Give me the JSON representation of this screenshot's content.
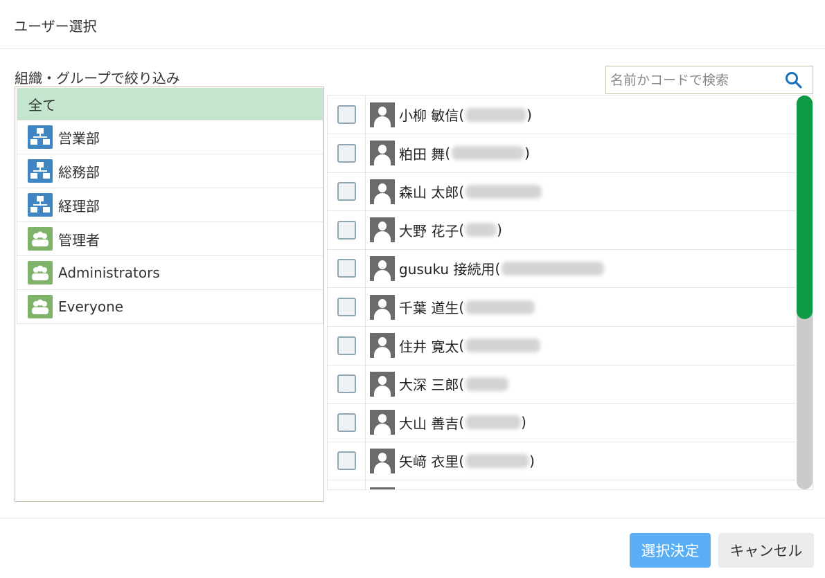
{
  "dialog": {
    "title": "ユーザー選択"
  },
  "filter": {
    "label": "組織・グループで絞り込み",
    "groups": [
      {
        "label": "全て",
        "type": "all",
        "selected": true
      },
      {
        "label": "営業部",
        "type": "organization-icon"
      },
      {
        "label": "総務部",
        "type": "organization-icon"
      },
      {
        "label": "経理部",
        "type": "organization-icon"
      },
      {
        "label": "管理者",
        "type": "group-icon"
      },
      {
        "label": "Administrators",
        "type": "group-icon"
      },
      {
        "label": "Everyone",
        "type": "group-icon"
      }
    ]
  },
  "search": {
    "placeholder": "名前かコードで検索",
    "icon": "search-icon"
  },
  "users": [
    {
      "name": "小柳 敏信",
      "open": "(",
      "close": ")"
    },
    {
      "name": "粕田 舞",
      "open": "(",
      "close": ")"
    },
    {
      "name": "森山 太郎",
      "open": "(",
      "close": ""
    },
    {
      "name": "大野 花子",
      "open": "(",
      "close": ")"
    },
    {
      "name": "gusuku 接続用",
      "open": "(",
      "close": ""
    },
    {
      "name": "千葉 道生",
      "open": "(",
      "close": ""
    },
    {
      "name": "住井 寛太",
      "open": "(",
      "close": ""
    },
    {
      "name": "大深 三郎",
      "open": "(",
      "close": ""
    },
    {
      "name": "大山 善吉",
      "open": "(",
      "close": ")"
    },
    {
      "name": "矢﨑 衣里",
      "open": "(",
      "close": ")"
    }
  ],
  "buttons": {
    "ok": "選択決定",
    "cancel": "キャンセル"
  },
  "colors": {
    "accent_green": "#0d9b47",
    "selected_row": "#c4e6cf",
    "ok_button": "#5aaef5",
    "org_icon": "#3f86c2",
    "group_icon": "#7fb36a"
  }
}
